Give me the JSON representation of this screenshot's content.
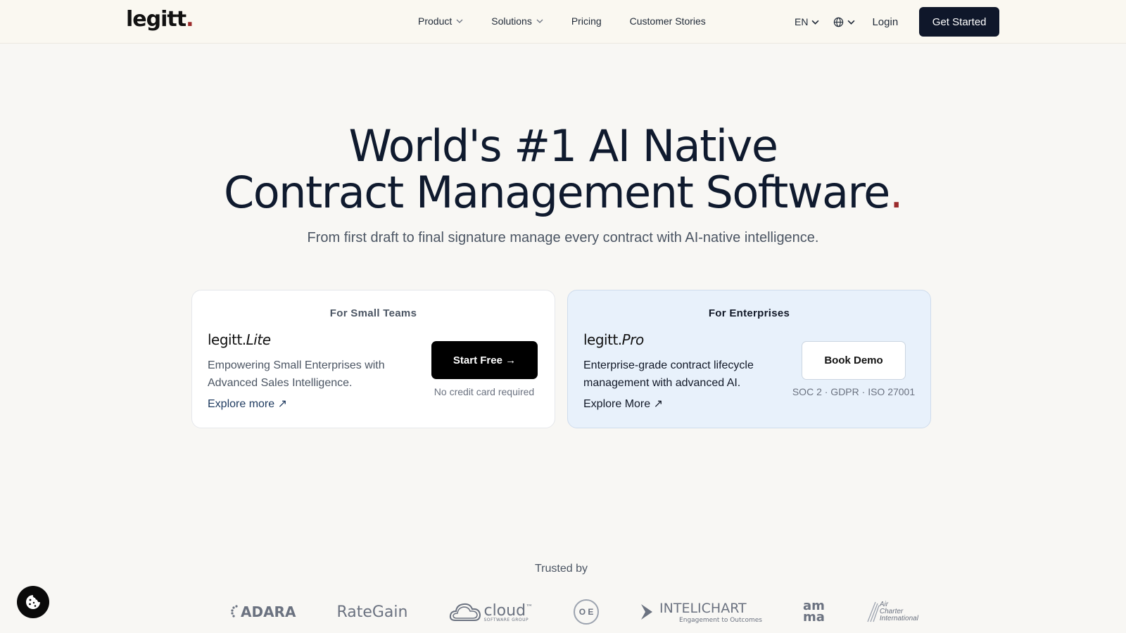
{
  "brand": {
    "name": "legitt",
    "dot": "."
  },
  "nav": {
    "links": [
      {
        "label": "Product",
        "dropdown": true
      },
      {
        "label": "Solutions",
        "dropdown": true
      },
      {
        "label": "Pricing",
        "dropdown": false
      },
      {
        "label": "Customer Stories",
        "dropdown": false
      }
    ],
    "language": "EN",
    "login": "Login",
    "cta": "Get Started"
  },
  "hero": {
    "title_line1": "World's #1 AI Native",
    "title_line2": "Contract Management Software",
    "title_dot": ".",
    "subtitle": "From first draft to final signature manage every contract with AI-native intelligence."
  },
  "cards": {
    "lite": {
      "tag": "For Small Teams",
      "brand": "legitt.",
      "brand_suffix": "Lite",
      "description": "Empowering Small Enterprises with Advanced Sales Intelligence.",
      "explore": "Explore more ↗",
      "button": "Start Free →",
      "note": "No credit card required"
    },
    "pro": {
      "tag": "For Enterprises",
      "brand": "legitt.",
      "brand_suffix": "Pro",
      "description": "Enterprise-grade contract lifecycle management with advanced AI.",
      "explore": "Explore More ↗",
      "button": "Book Demo",
      "note": "SOC 2 · GDPR · ISO 27001"
    }
  },
  "trusted": {
    "label": "Trusted by",
    "logos": {
      "adara": "ADARA",
      "rategain": "RateGain",
      "cloud": "cloud",
      "cloud_sub": "SOFTWARE GROUP",
      "ose": "O E",
      "intelichart": "INTELICHART",
      "intelichart_tag": "Engagement to Outcomes",
      "amma1": "am",
      "amma2": "ma",
      "air1": "Air",
      "air2": "Charter",
      "air3": "International"
    }
  },
  "colors": {
    "accent_dot": "#9b2c2c",
    "dark": "#0f172a",
    "pro_card": "#e8f1fb"
  }
}
